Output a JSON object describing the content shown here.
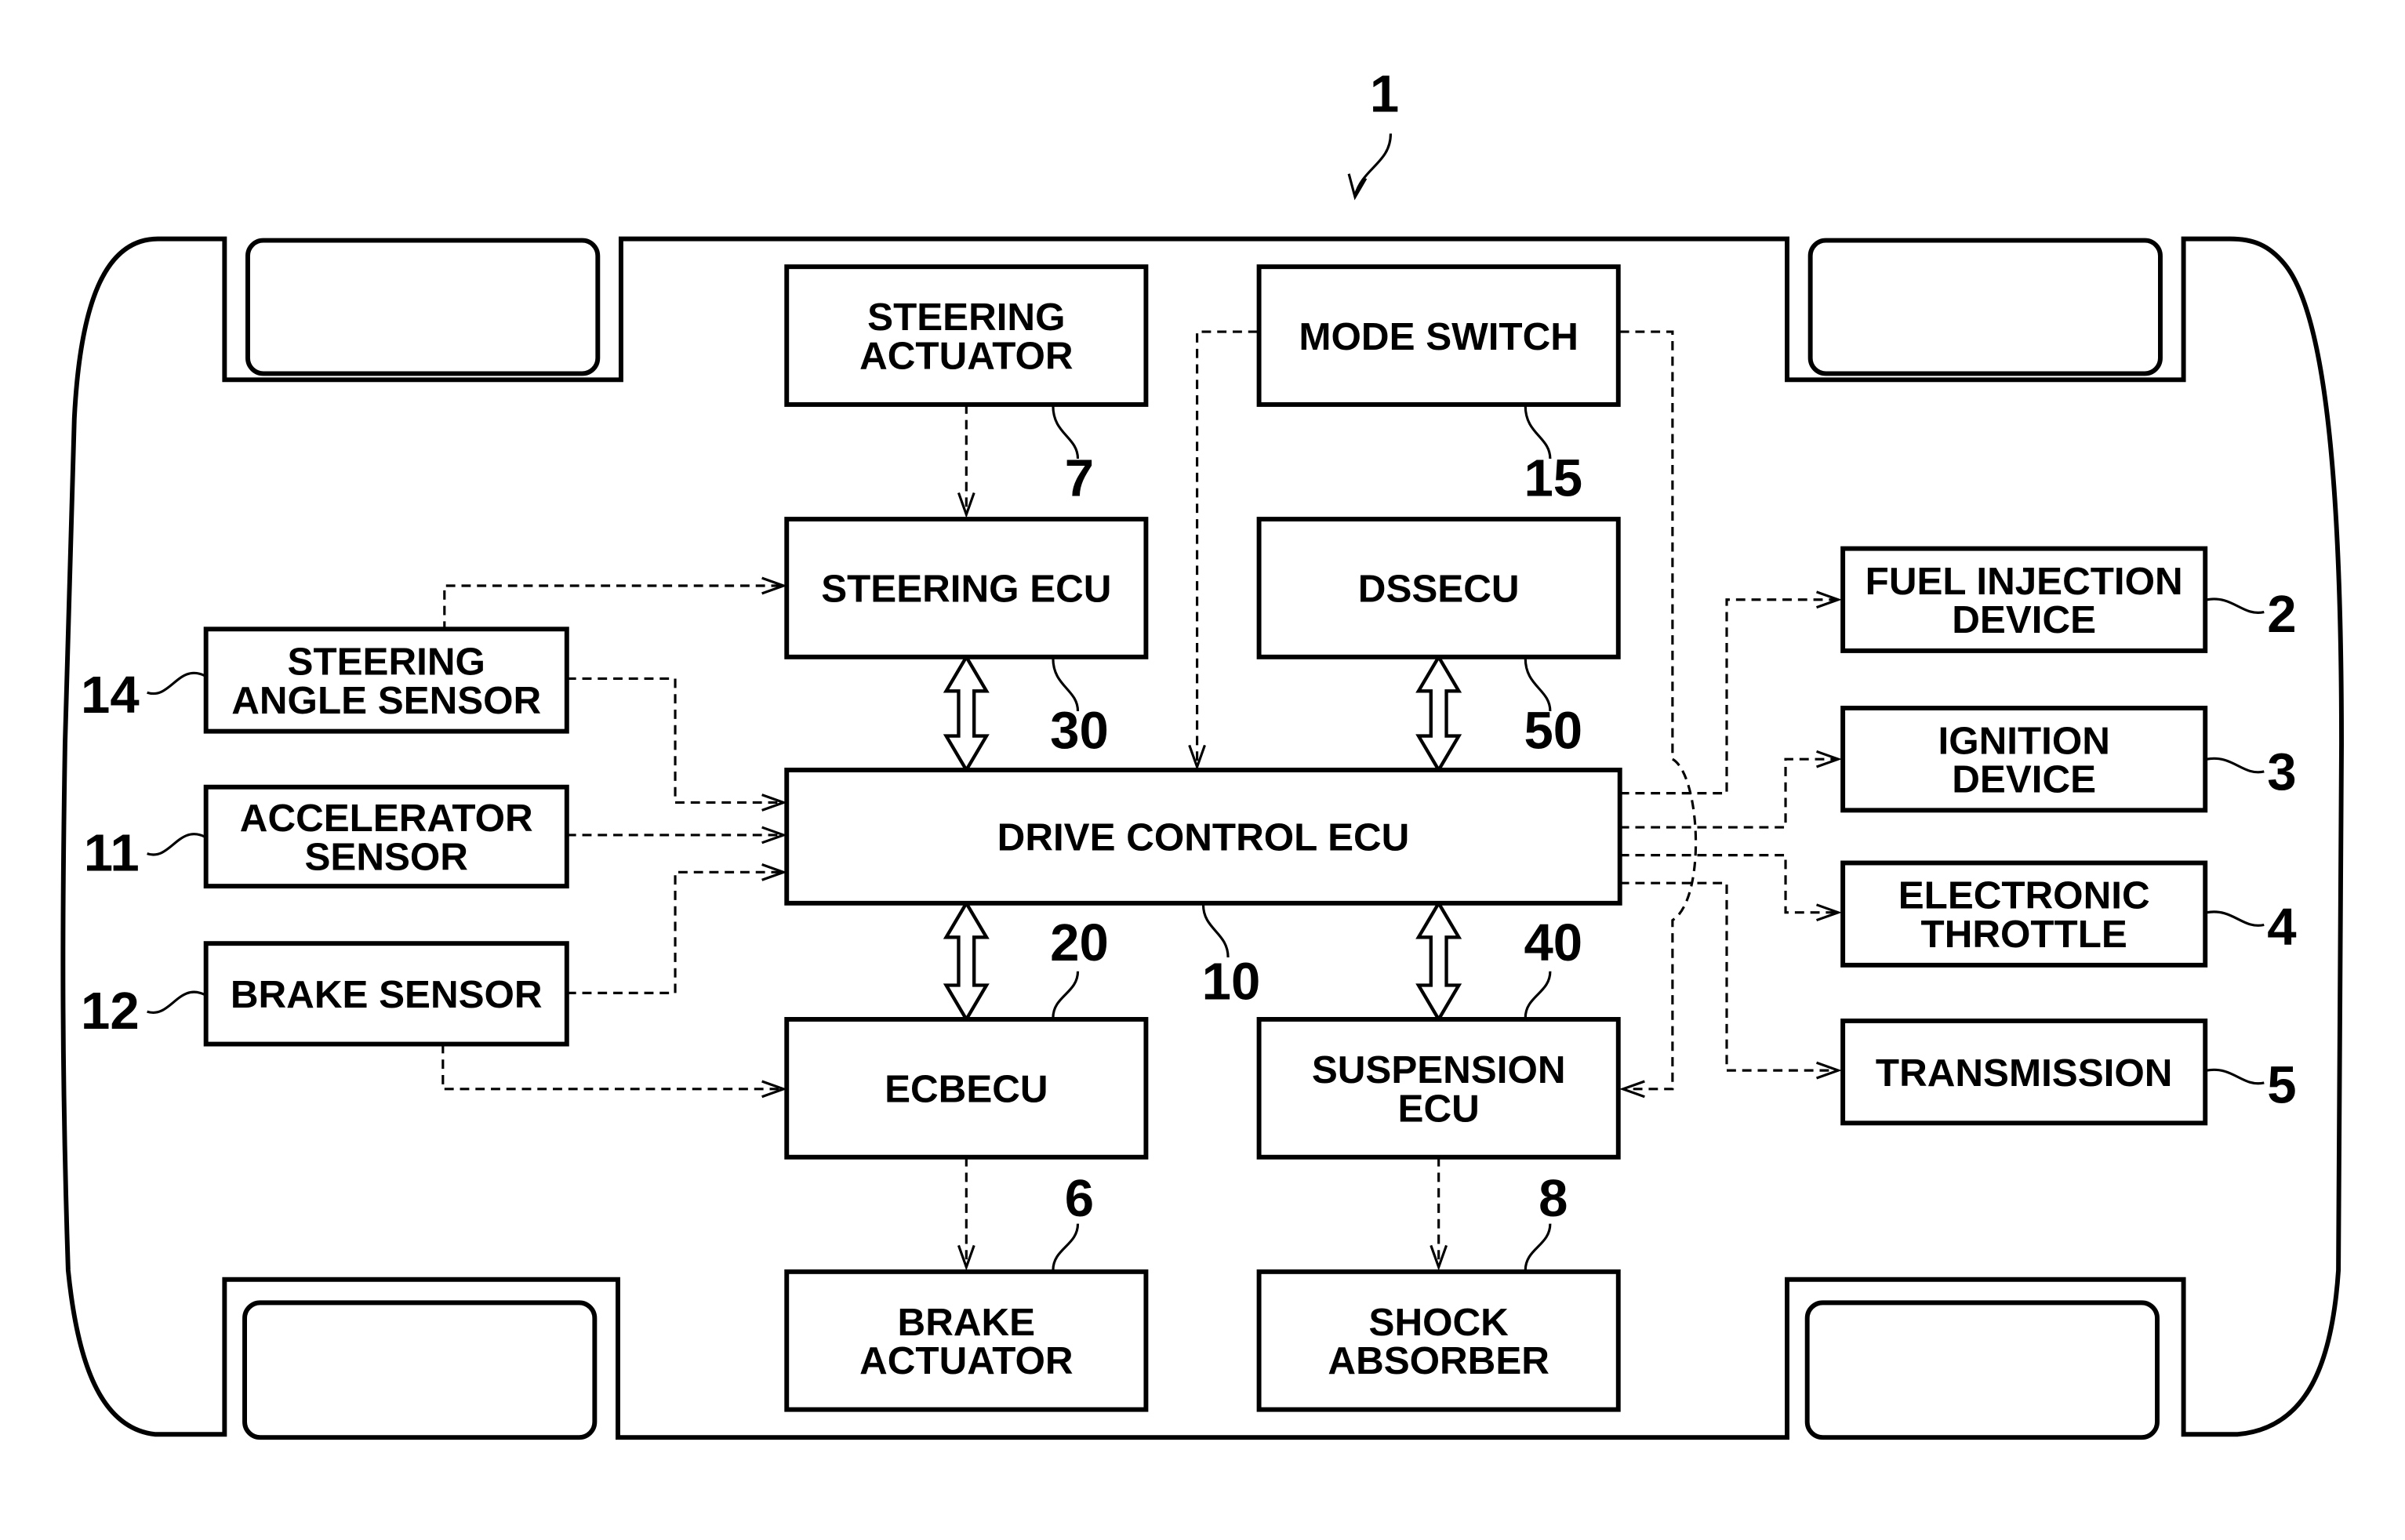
{
  "figure": {
    "vehicle_ref": "1",
    "blocks": {
      "steering_actuator": {
        "lines": [
          "STEERING",
          "ACTUATOR"
        ],
        "ref": "7"
      },
      "mode_switch": {
        "lines": [
          "MODE SWITCH"
        ],
        "ref": "15"
      },
      "steering_ecu": {
        "lines": [
          "STEERING ECU"
        ],
        "ref": "30"
      },
      "dssecu": {
        "lines": [
          "DSSECU"
        ],
        "ref": "50"
      },
      "steering_angle_sensor": {
        "lines": [
          "STEERING",
          "ANGLE SENSOR"
        ],
        "ref": "14"
      },
      "accelerator_sensor": {
        "lines": [
          "ACCELERATOR",
          "SENSOR"
        ],
        "ref": "11"
      },
      "brake_sensor": {
        "lines": [
          "BRAKE SENSOR"
        ],
        "ref": "12"
      },
      "drive_control_ecu": {
        "lines": [
          "DRIVE CONTROL ECU"
        ],
        "ref": "10"
      },
      "ecbecu": {
        "lines": [
          "ECBECU"
        ],
        "ref": "20"
      },
      "suspension_ecu": {
        "lines": [
          "SUSPENSION",
          "ECU"
        ],
        "ref": "40"
      },
      "brake_actuator": {
        "lines": [
          "BRAKE",
          "ACTUATOR"
        ],
        "ref": "6"
      },
      "shock_absorber": {
        "lines": [
          "SHOCK",
          "ABSORBER"
        ],
        "ref": "8"
      },
      "fuel_injection_device": {
        "lines": [
          "FUEL INJECTION",
          "DEVICE"
        ],
        "ref": "2"
      },
      "ignition_device": {
        "lines": [
          "IGNITION",
          "DEVICE"
        ],
        "ref": "3"
      },
      "electronic_throttle": {
        "lines": [
          "ELECTRONIC",
          "THROTTLE"
        ],
        "ref": "4"
      },
      "transmission": {
        "lines": [
          "TRANSMISSION"
        ],
        "ref": "5"
      }
    }
  }
}
